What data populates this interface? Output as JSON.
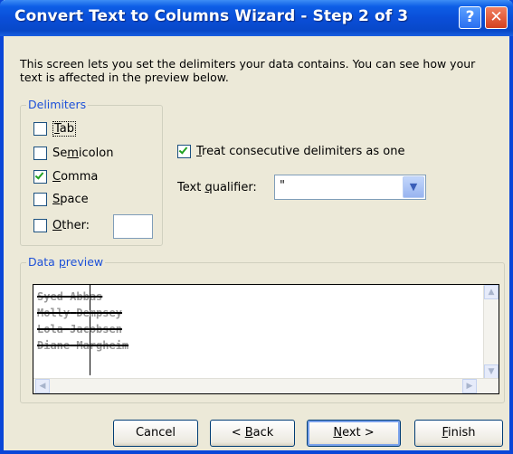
{
  "window": {
    "title": "Convert Text to Columns Wizard - Step 2 of 3",
    "help_glyph": "?",
    "close_glyph": "✕"
  },
  "description": "This screen lets you set the delimiters your data contains.  You can see how your text is affected in the preview below.",
  "delimiters": {
    "group_label": "Delimiters",
    "items": [
      {
        "label": "Tab",
        "checked": false
      },
      {
        "label": "Semicolon",
        "checked": false
      },
      {
        "label": "Comma",
        "checked": true
      },
      {
        "label": "Space",
        "checked": false
      },
      {
        "label": "Other:",
        "checked": false
      }
    ],
    "other_value": ""
  },
  "consecutive": {
    "label": "Treat consecutive delimiters as one",
    "checked": true
  },
  "qualifier": {
    "label": "Text qualifier:",
    "value": "\""
  },
  "preview": {
    "group_label": "Data preview",
    "rows": [
      [
        "Syed",
        "Abbas"
      ],
      [
        "Molly",
        "Dempsey"
      ],
      [
        "Lola",
        "Jacobsen"
      ],
      [
        "Diane",
        "Margheim"
      ]
    ]
  },
  "buttons": {
    "cancel": "Cancel",
    "back": "< Back",
    "next": "Next >",
    "finish": "Finish"
  },
  "colors": {
    "title_bar": "#0a4ed8",
    "dialog_bg": "#ece9d8",
    "group_label": "#1c50d8",
    "check": "#21a121"
  }
}
